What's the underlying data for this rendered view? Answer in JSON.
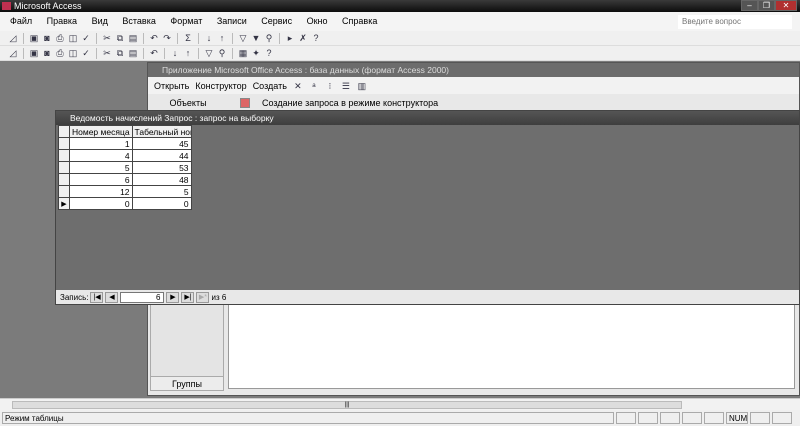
{
  "app": {
    "title": "Microsoft Access",
    "ask_placeholder": "Введите вопрос"
  },
  "menu": [
    "Файл",
    "Правка",
    "Вид",
    "Вставка",
    "Формат",
    "Записи",
    "Сервис",
    "Окно",
    "Справка"
  ],
  "db_window": {
    "title": "Приложение Microsoft Office Access : база данных (формат Access 2000)",
    "toolbar": {
      "open": "Открыть",
      "design": "Конструктор",
      "create": "Создать"
    },
    "objects_header": "Объекты",
    "create_query_item": "Создание запроса в режиме конструктора",
    "groups": "Группы"
  },
  "query_window": {
    "title": "Ведомость начислений Запрос : запрос на выборку",
    "columns": [
      "Номер месяца",
      "Табельный ном"
    ],
    "rows": [
      [
        "1",
        "45"
      ],
      [
        "4",
        "44"
      ],
      [
        "5",
        "53"
      ],
      [
        "6",
        "48"
      ],
      [
        "12",
        "5"
      ],
      [
        "0",
        "0"
      ]
    ],
    "nav": {
      "label": "Запись:",
      "current": "6",
      "of_label": "из 6"
    }
  },
  "status": {
    "mode": "Режим таблицы",
    "num": "NUM"
  }
}
